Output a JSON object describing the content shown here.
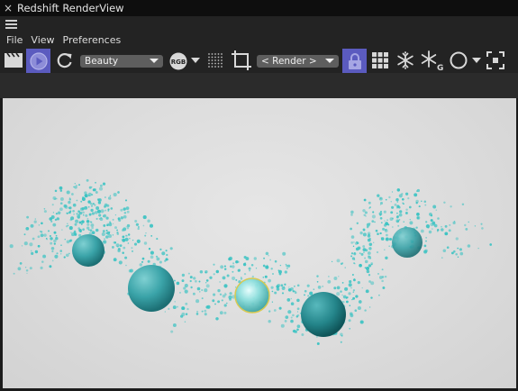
{
  "window": {
    "title": "Redshift RenderView",
    "close_glyph": "×"
  },
  "menu": {
    "items": [
      "File",
      "View",
      "Preferences"
    ]
  },
  "toolbar": {
    "aov_select": "Beauty",
    "channel_badge": "RGB",
    "camera_select": "< Render >",
    "snowflake_g_badge": "G",
    "icons": [
      "clapperboard-icon",
      "play-render-icon",
      "refresh-icon",
      "rgb-channel-icon",
      "dots-grid-icon",
      "crop-icon",
      "lock-icon",
      "grid-icon",
      "snowflake-icon",
      "snowflake-g-icon",
      "circle-icon",
      "focus-frame-icon"
    ],
    "accent_color": "#5b5bbf"
  },
  "render": {
    "background": "#dddddd",
    "particle_color": "#3cc3c3",
    "sphere_color": "#2e9aa0"
  }
}
